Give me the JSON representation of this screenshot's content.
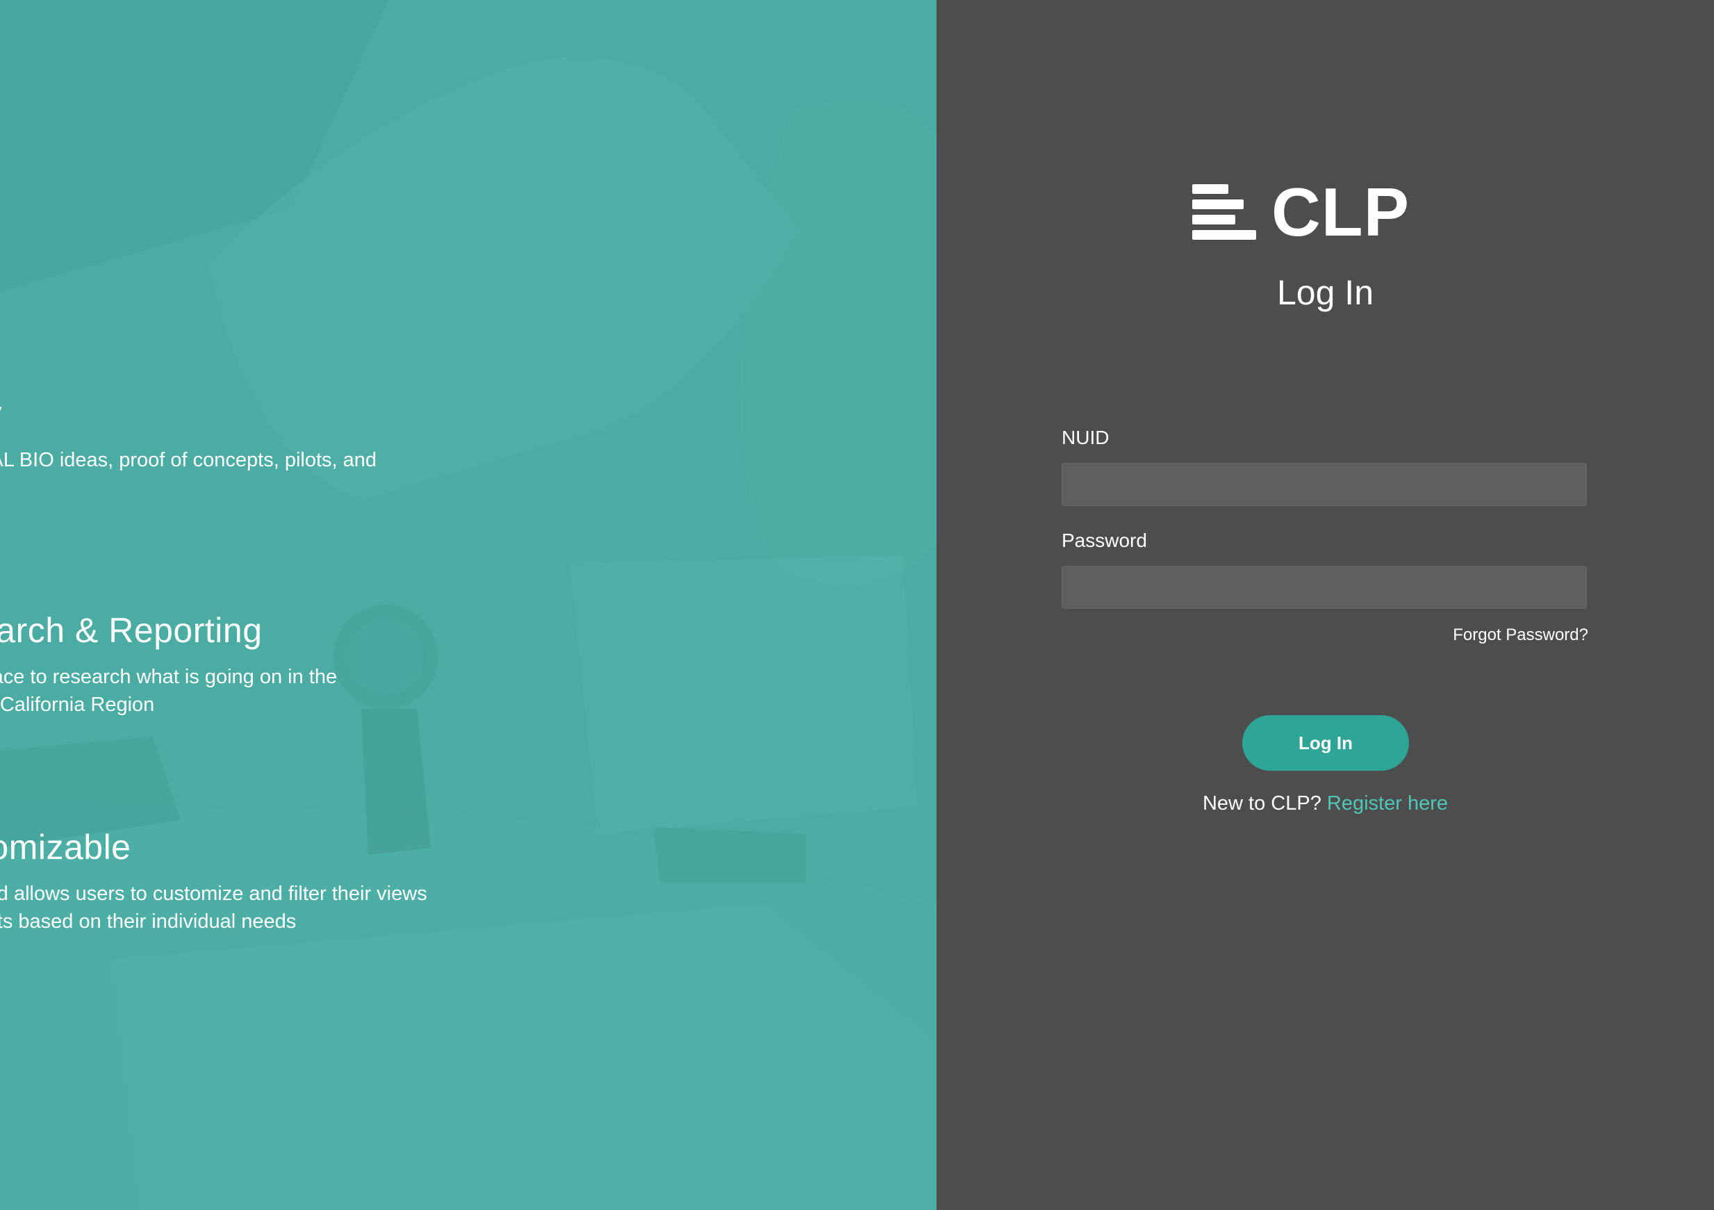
{
  "left": {
    "features": [
      {
        "title": "bility",
        "description": "all SCAL BIO ideas, proof of concepts, pilots, and\ns"
      },
      {
        "title": "earch & Reporting",
        "description": "place to research what is going on in the\nrn California Region"
      },
      {
        "title": "tomizable",
        "description": "ard allows users to customize and filter their views\norts based on their individual needs"
      }
    ]
  },
  "right": {
    "logo_text": "CLP",
    "form_title": "Log In",
    "nuid_label": "NUID",
    "nuid_value": "",
    "password_label": "Password",
    "password_value": "",
    "forgot_label": "Forgot Password?",
    "login_button_label": "Log In",
    "register_prompt": "New to CLP?",
    "register_link_label": "Register here"
  },
  "colors": {
    "left_panel_bg": "#4aada3",
    "right_panel_bg": "#4d4d4d",
    "input_bg": "#5f5f5f",
    "accent_button": "#2fa597",
    "link": "#4fc6b7"
  },
  "icons": {
    "logo": "stacked-bars-logo-icon"
  }
}
